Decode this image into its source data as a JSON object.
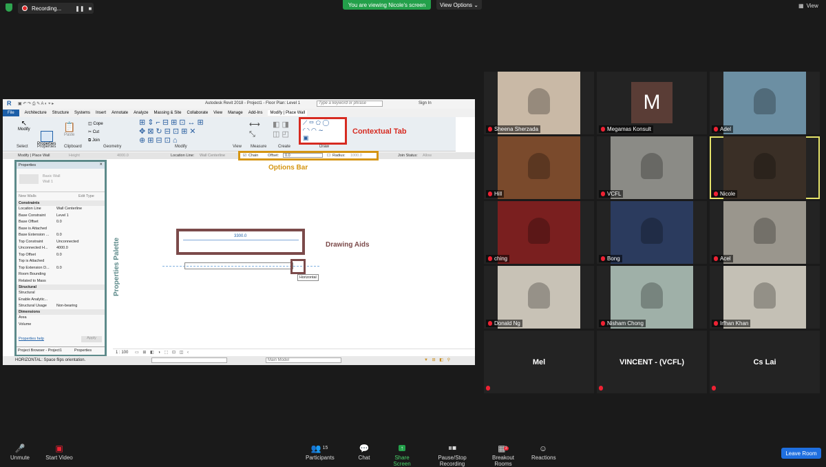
{
  "topbar": {
    "recording": "Recording...",
    "viewing": "You are viewing Nicole's screen",
    "view_options": "View Options",
    "view": "View"
  },
  "revit": {
    "title": "Autodesk Revit 2018 - Project1 - Floor Plan: Level 1",
    "search_placeholder": "Type a keyword or phrase",
    "sign_in": "Sign In",
    "tabs": [
      "File",
      "Architecture",
      "Structure",
      "Systems",
      "Insert",
      "Annotate",
      "Analyze",
      "Massing & Site",
      "Collaborate",
      "View",
      "Manage",
      "Add-Ins",
      "Modify | Place Wall"
    ],
    "ribbon_groups": [
      "Select",
      "Properties",
      "Clipboard",
      "Geometry",
      "Modify",
      "View",
      "Measure",
      "Create",
      "Draw"
    ],
    "ribbon_small": {
      "modify": "Modify",
      "properties": "Properties",
      "paste": "Paste",
      "cope": "Cope",
      "cut": "Cut",
      "join": "Join"
    },
    "options_bar": {
      "context": "Modify | Place Wall",
      "height": "Height",
      "height_val": "4000.0",
      "location_line": "Location Line:",
      "location_val": "Wall Centerline",
      "chain": "Chain",
      "offset": "Offset:",
      "offset_val": "0.0",
      "radius": "Radius:",
      "radius_val": "1000.0",
      "join_status": "Join Status:",
      "join_val": "Allow"
    },
    "properties": {
      "title": "Properties",
      "type1": "Basic Wall",
      "type2": "Wall 1",
      "new_walls": "New Walls",
      "edit_type": "Edit Type",
      "sections": {
        "constraints": "Constraints",
        "structural": "Structural",
        "dimensions": "Dimensions"
      },
      "rows": [
        [
          "Location Line",
          "Wall Centerline"
        ],
        [
          "Base Constraint",
          "Level 1"
        ],
        [
          "Base Offset",
          "0.0"
        ],
        [
          "Base is Attached",
          ""
        ],
        [
          "Base Extension ...",
          "0.0"
        ],
        [
          "Top Constraint",
          "Unconnected"
        ],
        [
          "Unconnected H...",
          "4000.0"
        ],
        [
          "Top Offset",
          "0.0"
        ],
        [
          "Top is Attached",
          ""
        ],
        [
          "Top Extension D...",
          "0.0"
        ],
        [
          "Room Bounding",
          ""
        ],
        [
          "Related to Mass",
          ""
        ]
      ],
      "struct_rows": [
        [
          "Structural",
          ""
        ],
        [
          "Enable Analytic...",
          ""
        ],
        [
          "Structural Usage",
          "Non-bearing"
        ]
      ],
      "dim_rows": [
        [
          "Area",
          ""
        ],
        [
          "Volume",
          ""
        ]
      ],
      "help": "Properties help",
      "apply": "Apply",
      "tab1": "Project Browser - Project1",
      "tab2": "Properties"
    },
    "dimension": "3300.0",
    "tooltip": "Horizontal",
    "scale": "1 : 100",
    "status": "HORIZONTAL:  Space flips orientation.",
    "model": "Main Model",
    "annotations": {
      "contextual": "Contextual Tab",
      "options": "Options Bar",
      "drawing": "Drawing Aids",
      "palette": "Properties Palette"
    }
  },
  "participants": [
    {
      "name": "Sheena Sherzada",
      "type": "video",
      "bg": "#c9b9a6"
    },
    {
      "name": "Megamas Konsult",
      "type": "avatar",
      "initial": "M",
      "bg": "#5a3d36"
    },
    {
      "name": "Adel",
      "type": "video",
      "bg": "#6c8fa3"
    },
    {
      "name": "Hill",
      "type": "video",
      "bg": "#7a4a2c"
    },
    {
      "name": "VCFL",
      "type": "video",
      "bg": "#8b8b86"
    },
    {
      "name": "Nicole",
      "type": "video",
      "bg": "#3a2f26",
      "active": true
    },
    {
      "name": "ching",
      "type": "video",
      "bg": "#7a1f1f"
    },
    {
      "name": "Bong",
      "type": "video",
      "bg": "#2b3b5e"
    },
    {
      "name": "Acel",
      "type": "video",
      "bg": "#9a968d"
    },
    {
      "name": "Donald Ng",
      "type": "video",
      "bg": "#c8c2b6"
    },
    {
      "name": "Nisham Chong",
      "type": "video",
      "bg": "#9fb0a8"
    },
    {
      "name": "Irfhan Khan",
      "type": "video",
      "bg": "#c4c0b5"
    },
    {
      "name": "Mel",
      "type": "name"
    },
    {
      "name": "VINCENT - (VCFL)",
      "type": "name"
    },
    {
      "name": "Cs Lai",
      "type": "name"
    }
  ],
  "bottombar": {
    "unmute": "Unmute",
    "start_video": "Start Video",
    "participants": "Participants",
    "participants_count": "15",
    "chat": "Chat",
    "share_screen": "Share Screen",
    "record": "Pause/Stop Recording",
    "breakout": "Breakout Rooms",
    "breakout_badge": "3",
    "reactions": "Reactions",
    "leave": "Leave Room"
  },
  "colors": {
    "accent_green": "#23a04a",
    "leave_blue": "#1f6fe0",
    "active_border": "#e6e46a"
  }
}
